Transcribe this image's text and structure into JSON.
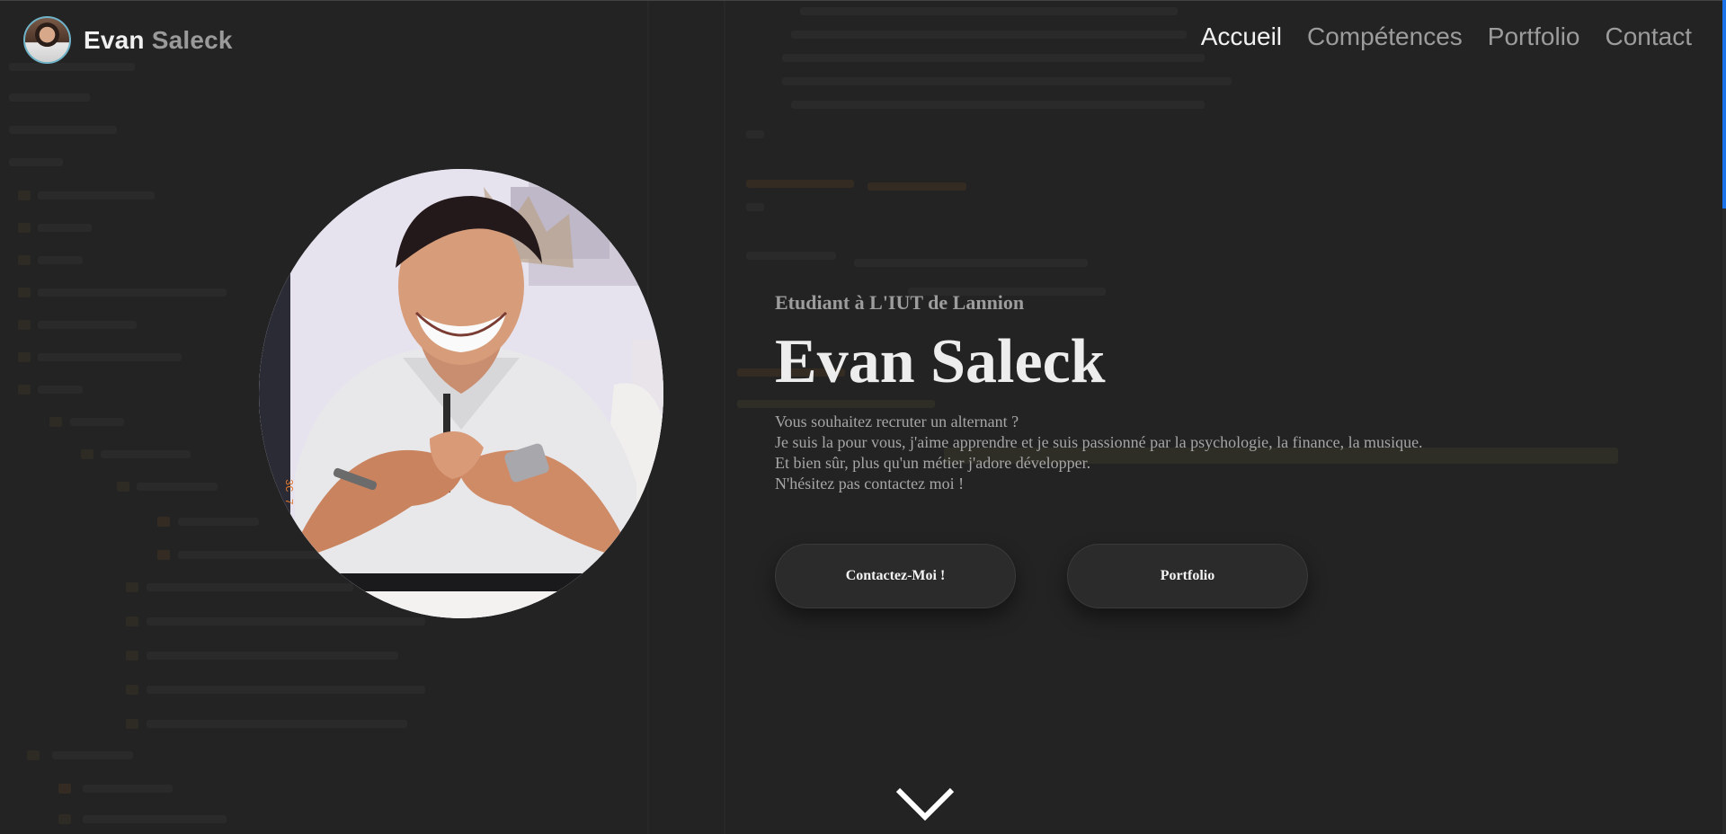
{
  "navbar": {
    "brand_first": "Evan",
    "brand_last": "Saleck",
    "links": [
      {
        "label": "Accueil",
        "active": true
      },
      {
        "label": "Compétences",
        "active": false
      },
      {
        "label": "Portfolio",
        "active": false
      },
      {
        "label": "Contact",
        "active": false
      }
    ]
  },
  "hero": {
    "subtitle": "Etudiant à L'IUT de Lannion",
    "title": "Evan Saleck",
    "intro": [
      "Vous souhaitez recruter un alternant ?",
      "Je suis la pour vous, j'aime apprendre et je suis passionné par la psychologie, la finance, la musique.",
      "Et bien sûr, plus qu'un métier j'adore développer.",
      "N'hésitez pas contactez moi !"
    ],
    "buttons": {
      "contact": "Contactez-Moi !",
      "portfolio": "Portfolio"
    }
  },
  "icons": {
    "scroll_down": "chevron-down-icon",
    "avatar": "avatar"
  },
  "colors": {
    "background": "#232323",
    "accent_scroll": "#1a73e8",
    "avatar_ring": "#6fb3c9"
  }
}
